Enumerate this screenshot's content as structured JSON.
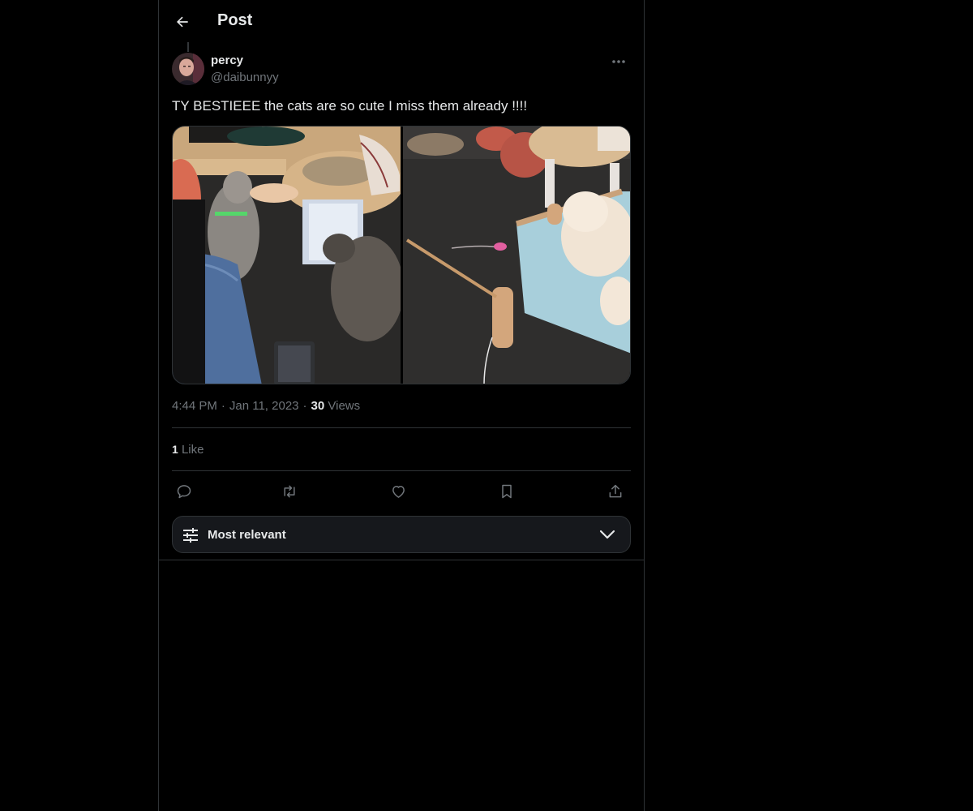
{
  "header": {
    "title": "Post",
    "back_icon": "arrow-left-icon"
  },
  "post": {
    "author": {
      "display_name": "percy",
      "handle": "@daibunnyy"
    },
    "text": "TY BESTIEEE the cats are so cute I miss them already !!!!",
    "media": [
      {
        "type": "photo",
        "subject": "cats"
      },
      {
        "type": "photo",
        "subject": "cats"
      }
    ],
    "time": "4:44 PM",
    "date": "Jan 11, 2023",
    "views_count": "30",
    "views_label": "Views",
    "likes_count": "1",
    "likes_label": "Like",
    "more_icon": "more-horizontal-icon"
  },
  "actions": [
    {
      "name": "reply",
      "icon": "reply-icon"
    },
    {
      "name": "repost",
      "icon": "repost-icon"
    },
    {
      "name": "like",
      "icon": "heart-icon"
    },
    {
      "name": "bookmark",
      "icon": "bookmark-icon"
    },
    {
      "name": "share",
      "icon": "share-icon"
    }
  ],
  "sort": {
    "label": "Most relevant",
    "icon": "sliders-icon",
    "chevron": "chevron-down-icon"
  },
  "colors": {
    "background": "#000000",
    "text_primary": "#e7e9ea",
    "text_secondary": "#71767b",
    "border": "#2f3336",
    "sort_bg": "#16181c"
  }
}
